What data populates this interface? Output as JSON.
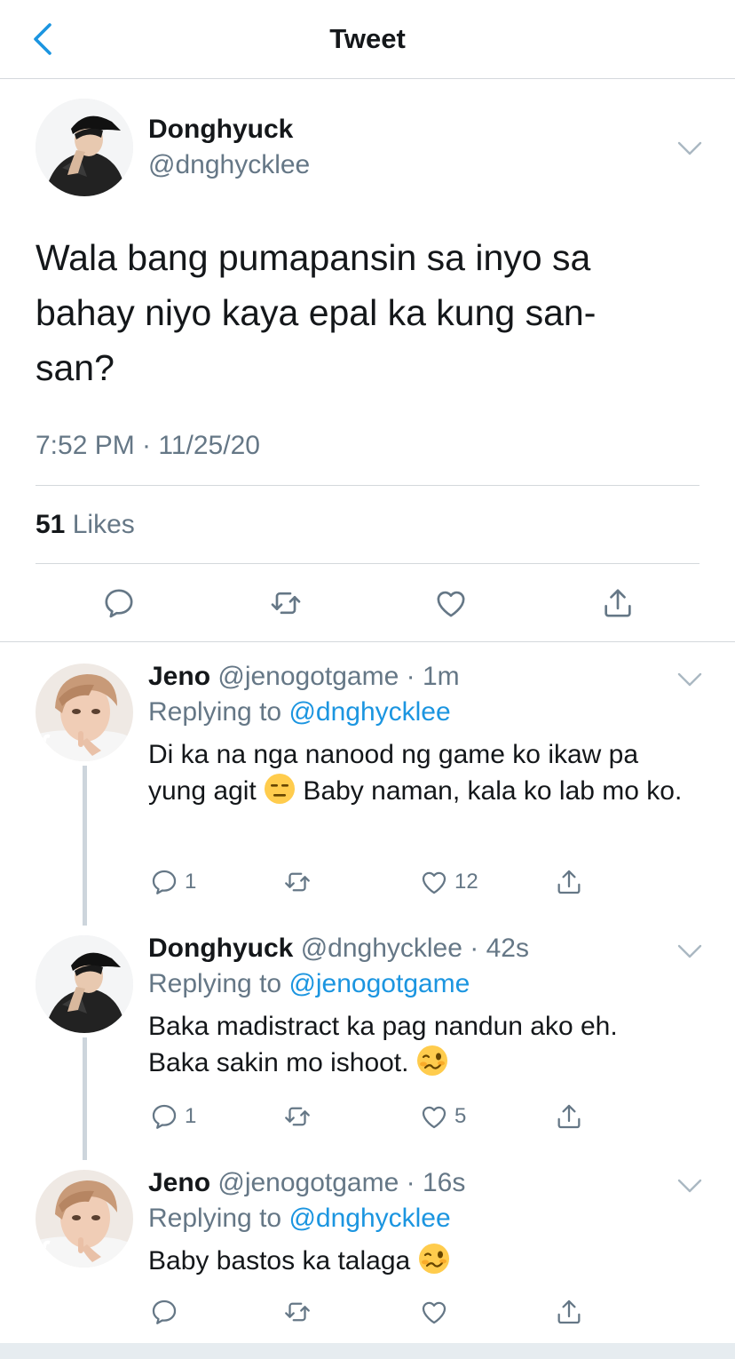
{
  "header": {
    "title": "Tweet"
  },
  "main_tweet": {
    "name": "Donghyuck",
    "handle": "@dnghycklee",
    "text": "Wala bang pumapansin sa inyo sa bahay niyo kaya epal ka kung san-san?",
    "timestamp": "7:52 PM · 11/25/20",
    "likes_count": "51",
    "likes_label": "Likes"
  },
  "replies": [
    {
      "name": "Jeno",
      "handle": "@jenogotgame",
      "time": "· 1m",
      "replying_label": "Replying to",
      "replying_to": "@dnghycklee",
      "text_before": "Di ka na nga nanood ng game ko ikaw pa yung agit ",
      "emoji": "expressionless-face",
      "text_after": " Baby naman, kala ko lab mo ko.",
      "reply_count": "1",
      "retweet_count": "",
      "like_count": "12"
    },
    {
      "name": "Donghyuck",
      "handle": "@dnghycklee",
      "time": "· 42s",
      "replying_label": "Replying to",
      "replying_to": "@jenogotgame",
      "text_before": "Baka madistract ka pag nandun ako eh. Baka sakin mo ishoot. ",
      "emoji": "woozy-face",
      "text_after": "",
      "reply_count": "1",
      "retweet_count": "",
      "like_count": "5"
    },
    {
      "name": "Jeno",
      "handle": "@jenogotgame",
      "time": "· 16s",
      "replying_label": "Replying to",
      "replying_to": "@dnghycklee",
      "text_before": "Baby bastos ka talaga ",
      "emoji": "woozy-face",
      "text_after": "",
      "reply_count": "",
      "retweet_count": "",
      "like_count": ""
    }
  ],
  "colors": {
    "accent": "#1b95e0",
    "secondary_text": "#657786",
    "divider": "#d4d8dc"
  }
}
